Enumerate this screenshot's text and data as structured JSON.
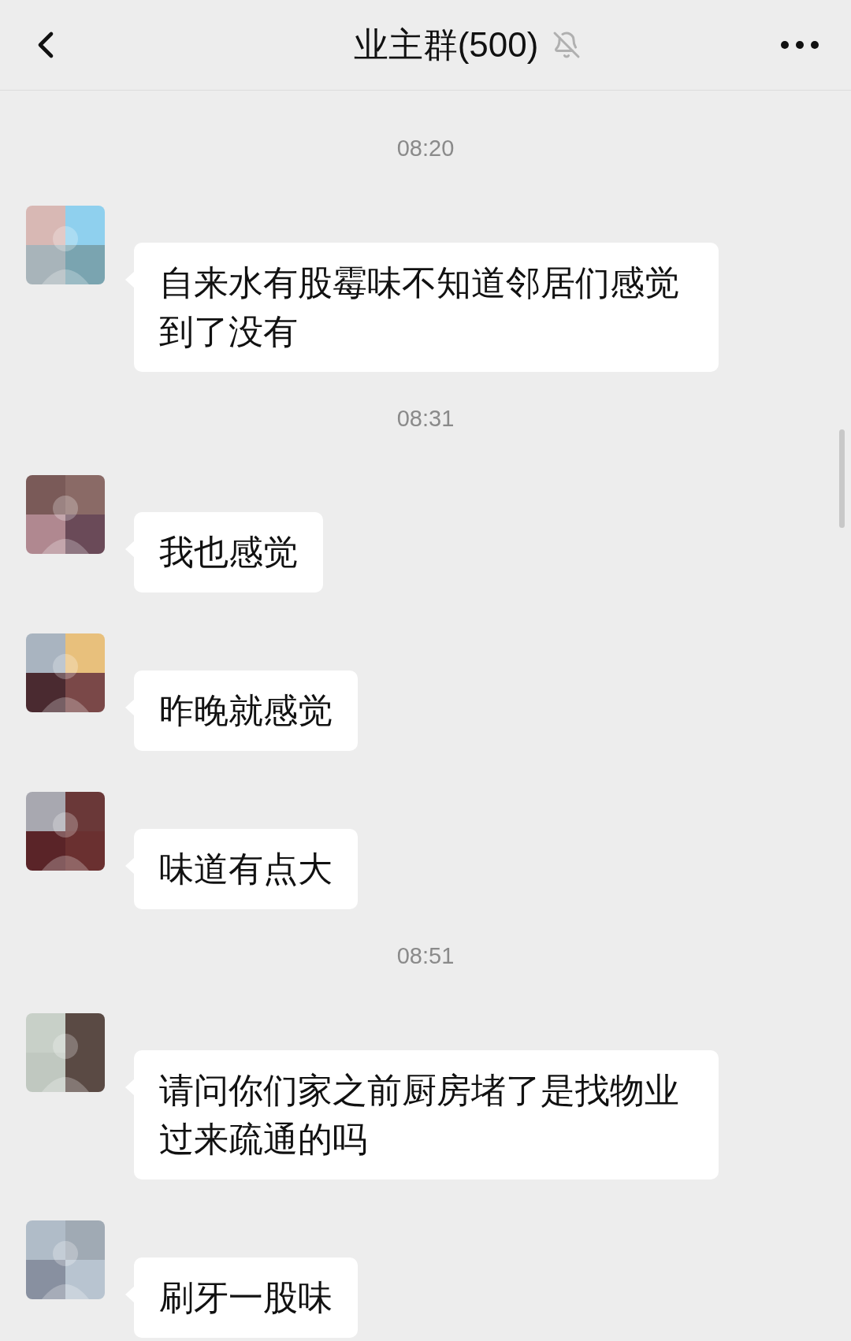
{
  "header": {
    "title": "业主群(500)",
    "muted": true
  },
  "messages": [
    {
      "kind": "time",
      "text": "08:20"
    },
    {
      "kind": "message",
      "text": "自来水有股霉味不知道邻居们感觉到了没有"
    },
    {
      "kind": "time",
      "text": "08:31"
    },
    {
      "kind": "message",
      "text": "我也感觉"
    },
    {
      "kind": "message",
      "text": "昨晚就感觉"
    },
    {
      "kind": "message",
      "text": "味道有点大"
    },
    {
      "kind": "time",
      "text": "08:51"
    },
    {
      "kind": "message",
      "text": "请问你们家之前厨房堵了是找物业过来疏通的吗"
    },
    {
      "kind": "message",
      "text": "刷牙一股味"
    }
  ]
}
